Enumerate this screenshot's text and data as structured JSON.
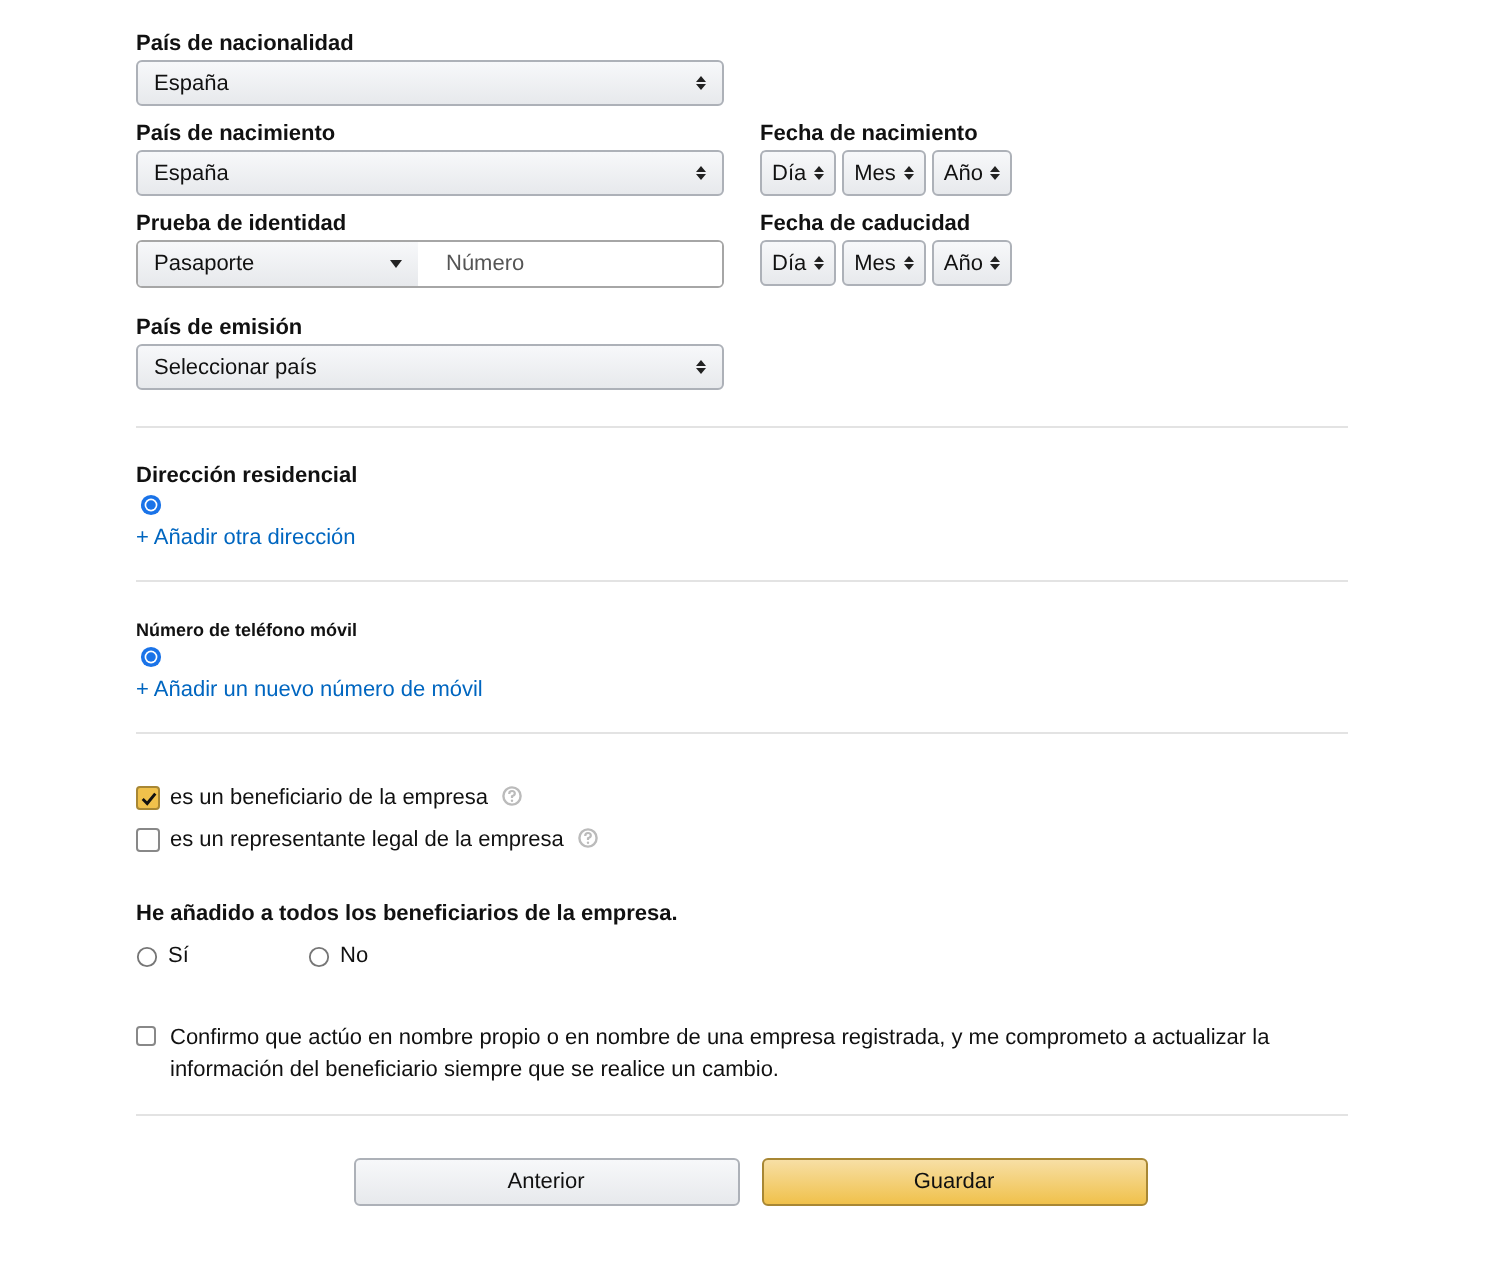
{
  "identity": {
    "nationality": {
      "label": "País de nacionalidad",
      "value": "España"
    },
    "birth_country": {
      "label": "País de nacimiento",
      "value": "España"
    },
    "birth_date": {
      "label": "Fecha de nacimiento",
      "parts": [
        "Día",
        "Mes",
        "Año"
      ]
    },
    "id_proof": {
      "label": "Prueba de identidad",
      "type": "Pasaporte",
      "placeholder": "Número"
    },
    "expiry_date": {
      "label": "Fecha de caducidad",
      "parts": [
        "Día",
        "Mes",
        "Año"
      ]
    },
    "issuing_country": {
      "label": "País de emisión",
      "value": "Seleccionar país"
    }
  },
  "address": {
    "title": "Dirección residencial",
    "options": [
      {
        "selected": true
      }
    ],
    "add_link": "+ Añadir otra dirección"
  },
  "mobile": {
    "title": "Número de teléfono móvil",
    "options": [
      {
        "selected": true
      }
    ],
    "add_link": "+ Añadir un nuevo número de móvil"
  },
  "roles": [
    {
      "label": "es un beneficiario de la empresa",
      "checked": true
    },
    {
      "label": "es un representante legal de la empresa",
      "checked": false
    }
  ],
  "all_added": {
    "question": "He añadido a todos los beneficiarios de la empresa.",
    "options": [
      {
        "label": "Sí",
        "selected": false
      },
      {
        "label": "No",
        "selected": false
      }
    ]
  },
  "confirmation": {
    "text": "Confirmo que actúo en nombre propio o en nombre de una empresa registrada, y me comprometo a actualizar la información del beneficiario siempre que se realice un cambio.",
    "checked": false
  },
  "buttons": [
    {
      "label": "Anterior",
      "kind": "secondary"
    },
    {
      "label": "Guardar",
      "kind": "primary"
    }
  ]
}
